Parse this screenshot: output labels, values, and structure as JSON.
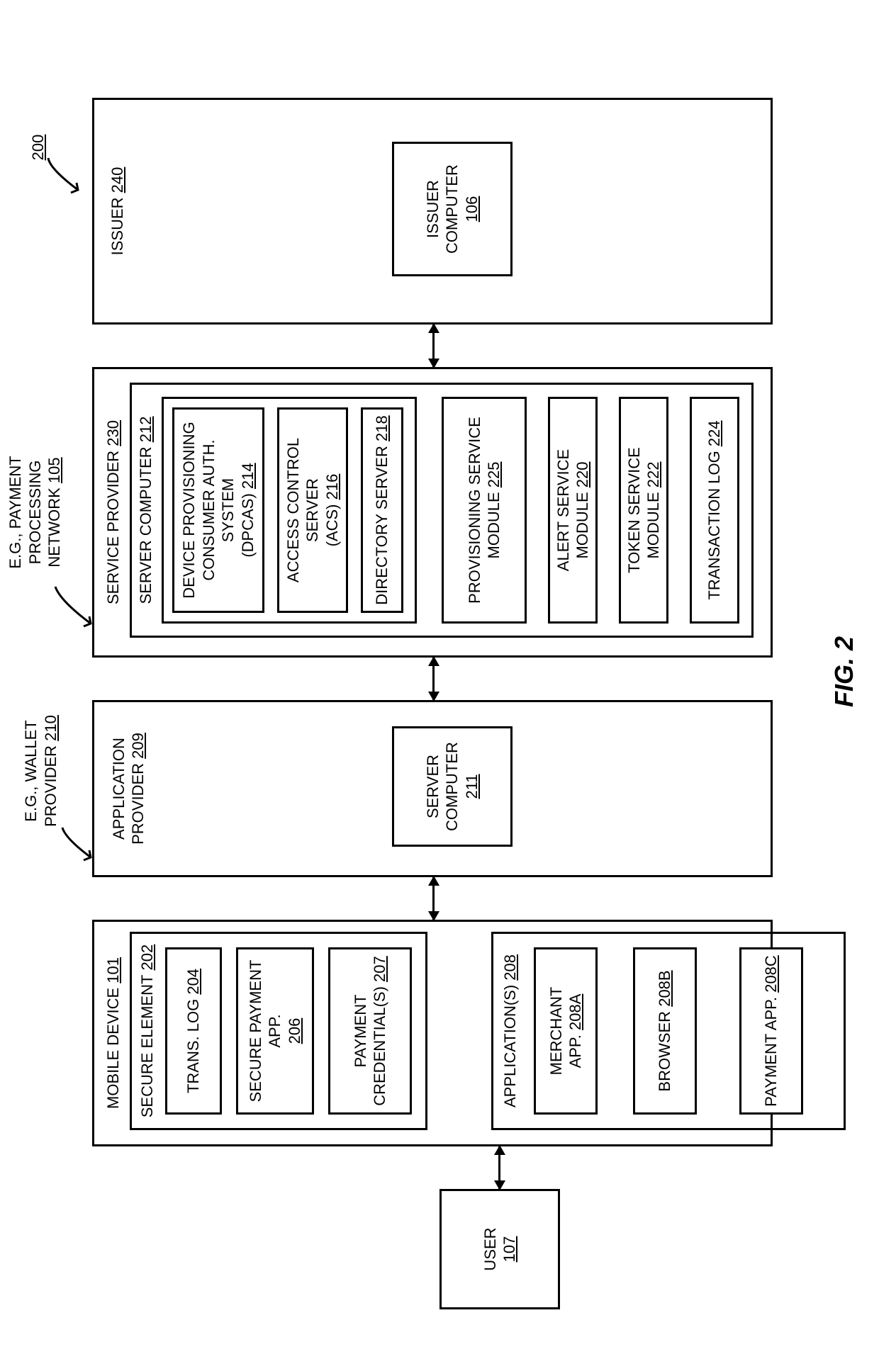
{
  "figure": {
    "caption": "FIG. 2",
    "ref": "200"
  },
  "callouts": {
    "wallet_provider": "E.G., WALLET\nPROVIDER",
    "wallet_provider_ref": "210",
    "ppn": "E.G., PAYMENT\nPROCESSING\nNETWORK",
    "ppn_ref": "105"
  },
  "user": {
    "label": "USER",
    "ref": "107"
  },
  "mobile": {
    "label": "MOBILE DEVICE",
    "ref": "101",
    "secure_element": {
      "label": "SECURE ELEMENT",
      "ref": "202",
      "trans_log": {
        "label": "TRANS. LOG",
        "ref": "204"
      },
      "secure_pay": {
        "label": "SECURE PAYMENT\nAPP.",
        "ref": "206"
      },
      "credentials": {
        "label": "PAYMENT\nCREDENTIAL(S)",
        "ref": "207"
      }
    },
    "apps": {
      "label": "APPLICATION(S)",
      "ref": "208",
      "merchant": {
        "label": "MERCHANT APP.",
        "ref": "208A"
      },
      "browser": {
        "label": "BROWSER",
        "ref": "208B"
      },
      "payment": {
        "label": "PAYMENT APP.",
        "ref": "208C"
      }
    }
  },
  "app_provider": {
    "label": "APPLICATION\nPROVIDER",
    "ref": "209",
    "server": {
      "label": "SERVER\nCOMPUTER",
      "ref": "211"
    }
  },
  "service_provider": {
    "label": "SERVICE PROVIDER",
    "ref": "230",
    "server_computer": {
      "label": "SERVER COMPUTER",
      "ref": "212",
      "dpcas": {
        "label": "DEVICE PROVISIONING\nCONSUMER AUTH. SYSTEM\n(DPCAS)",
        "ref": "214"
      },
      "acs": {
        "label": "ACCESS CONTROL SERVER\n(ACS)",
        "ref": "216"
      },
      "dir": {
        "label": "DIRECTORY SERVER",
        "ref": "218"
      }
    },
    "prov": {
      "label": "PROVISIONING SERVICE\nMODULE",
      "ref": "225"
    },
    "alert": {
      "label": "ALERT SERVICE MODULE",
      "ref": "220"
    },
    "token": {
      "label": "TOKEN SERVICE MODULE",
      "ref": "222"
    },
    "txnlog": {
      "label": "TRANSACTION LOG",
      "ref": "224"
    }
  },
  "issuer": {
    "label": "ISSUER",
    "ref": "240",
    "computer": {
      "label": "ISSUER\nCOMPUTER",
      "ref": "106"
    }
  }
}
